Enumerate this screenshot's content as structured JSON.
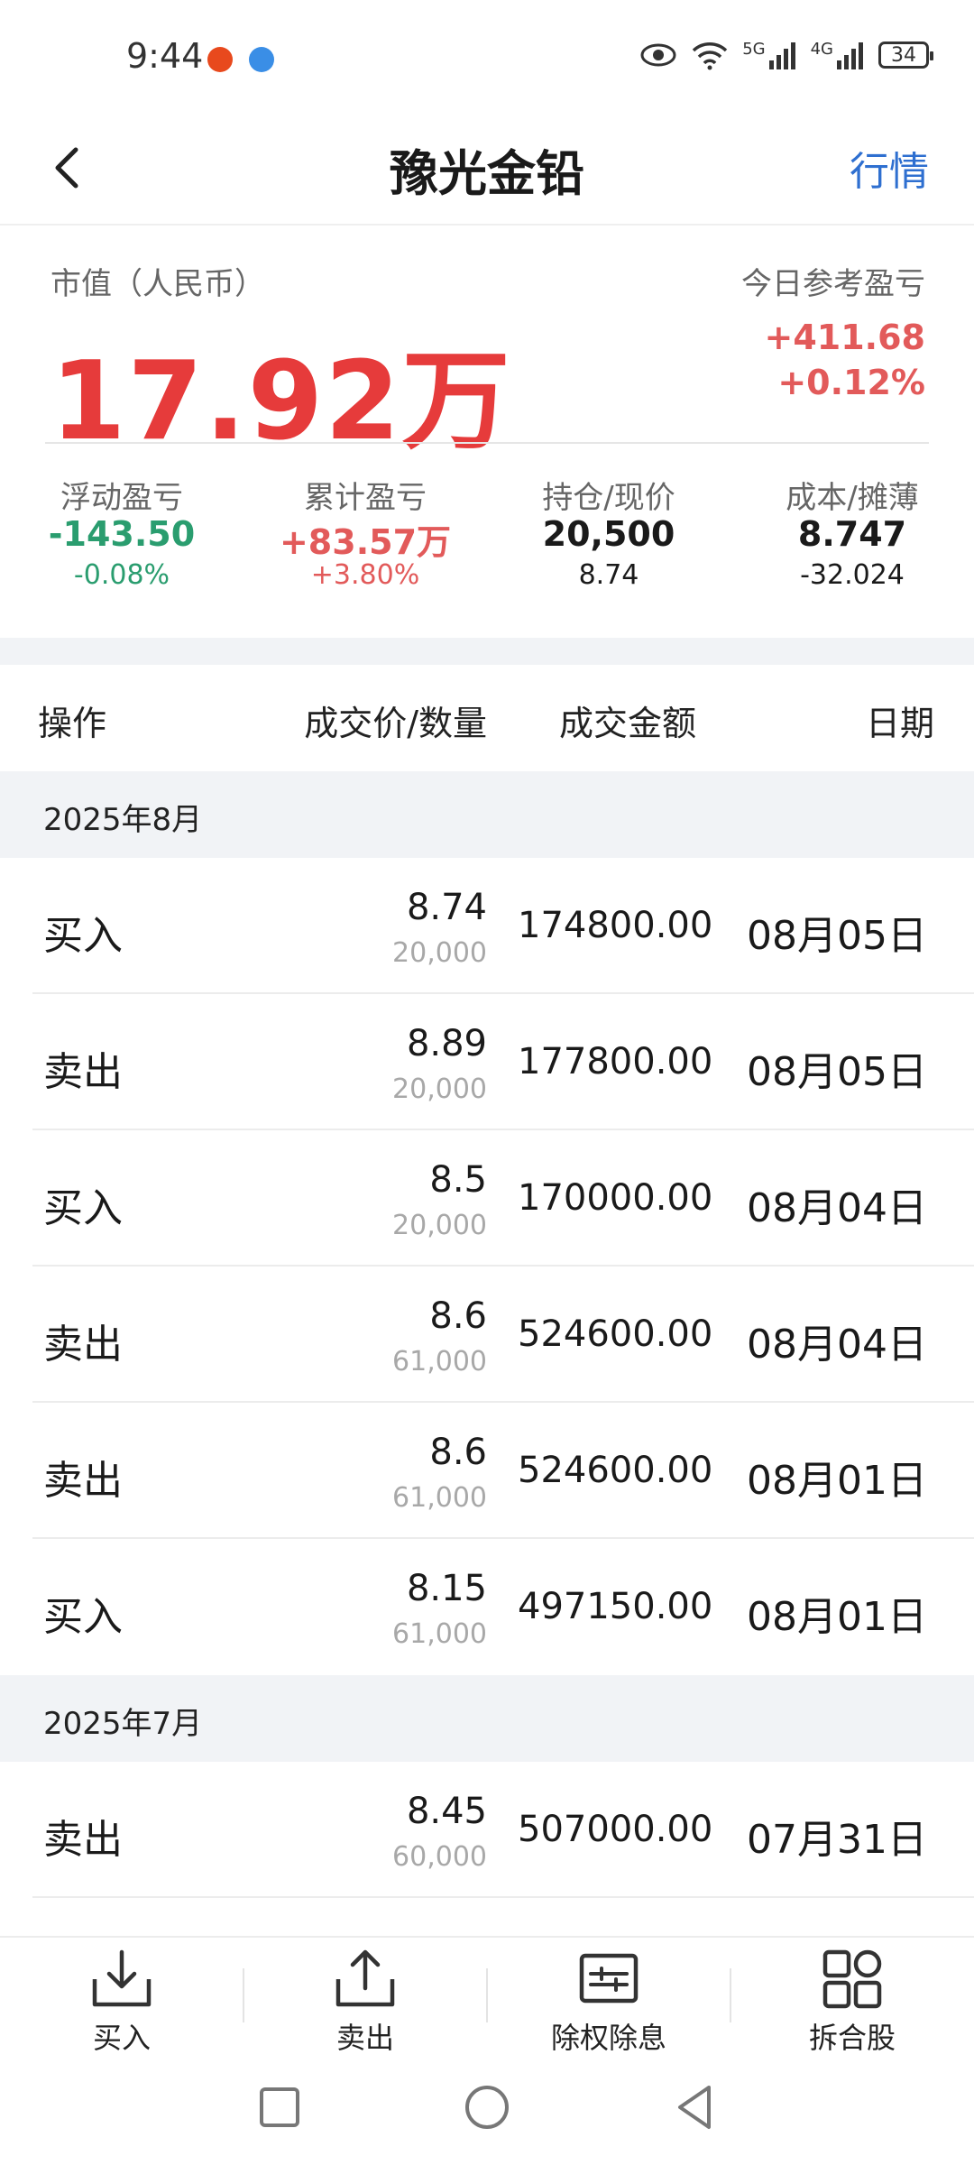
{
  "status_bar": {
    "time": "9:44",
    "network_1": "5G",
    "network_2": "4G",
    "battery": "34"
  },
  "header": {
    "title": "豫光金铅",
    "quote_label": "行情"
  },
  "summary": {
    "market_value_label": "市值（人民币）",
    "market_value": "17.92万",
    "today_pl_label": "今日参考盈亏",
    "today_pl_amount": "+411.68",
    "today_pl_pct": "+0.12%",
    "stats": [
      {
        "label": "浮动盈亏",
        "value": "-143.50",
        "sub": "-0.08%"
      },
      {
        "label": "累计盈亏",
        "value": "+83.57万",
        "sub": "+3.80%"
      },
      {
        "label": "持仓/现价",
        "value": "20,500",
        "sub": "8.74"
      },
      {
        "label": "成本/摊薄",
        "value": "8.747",
        "sub": "-32.024"
      }
    ]
  },
  "table": {
    "headers": {
      "operation": "操作",
      "price_qty": "成交价/数量",
      "amount": "成交金额",
      "date": "日期"
    },
    "months": [
      {
        "label": "2025年8月",
        "rows": [
          {
            "op": "买入",
            "price": "8.74",
            "qty": "20,000",
            "amount": "174800.00",
            "date": "08月05日"
          },
          {
            "op": "卖出",
            "price": "8.89",
            "qty": "20,000",
            "amount": "177800.00",
            "date": "08月05日"
          },
          {
            "op": "买入",
            "price": "8.5",
            "qty": "20,000",
            "amount": "170000.00",
            "date": "08月04日"
          },
          {
            "op": "卖出",
            "price": "8.6",
            "qty": "61,000",
            "amount": "524600.00",
            "date": "08月04日"
          },
          {
            "op": "卖出",
            "price": "8.6",
            "qty": "61,000",
            "amount": "524600.00",
            "date": "08月01日"
          },
          {
            "op": "买入",
            "price": "8.15",
            "qty": "61,000",
            "amount": "497150.00",
            "date": "08月01日"
          }
        ]
      },
      {
        "label": "2025年7月",
        "rows": [
          {
            "op": "卖出",
            "price": "8.45",
            "qty": "60,000",
            "amount": "507000.00",
            "date": "07月31日"
          }
        ]
      }
    ]
  },
  "actions": {
    "buy": "买入",
    "sell": "卖出",
    "ex_rights": "除权除息",
    "split_merge": "拆合股"
  },
  "colors": {
    "red": "#e63b3b",
    "green": "#2a9d6f",
    "link_blue": "#2e6fd0"
  }
}
